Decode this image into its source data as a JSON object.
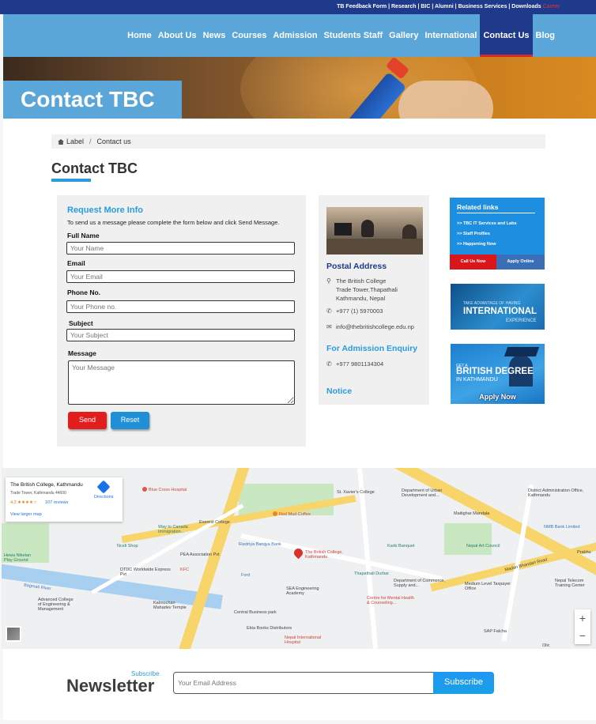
{
  "topbar": {
    "links": "TB Feedback Form | Research | BIC | Alumni | Business Services | Downloads",
    "career": "Career"
  },
  "nav": {
    "items": [
      {
        "label": "Home"
      },
      {
        "label": "About Us"
      },
      {
        "label": "News"
      },
      {
        "label": "Courses"
      },
      {
        "label": "Admission"
      },
      {
        "label": "Students Staff"
      },
      {
        "label": "Gallery"
      },
      {
        "label": "International"
      },
      {
        "label": "Contact Us"
      },
      {
        "label": "Blog"
      }
    ],
    "active": "Contact Us"
  },
  "hero": {
    "title": "Contact TBC"
  },
  "breadcrumb": {
    "home": "Label",
    "current": "Contact us"
  },
  "page_title": "Contact TBC",
  "form": {
    "heading": "Request More Info",
    "note": "To send us a message please complete the form below and click Send Message.",
    "full_name_label": "Full Name",
    "full_name_placeholder": "Your Name",
    "email_label": "Email",
    "email_placeholder": "Your Email",
    "phone_label": "Phone No.",
    "phone_placeholder": "Your Phone no.",
    "subject_label": "Subject",
    "subject_placeholder": "Your Subject",
    "message_label": "Message",
    "message_placeholder": "Your Message",
    "send_label": "Send",
    "reset_label": "Reset"
  },
  "info": {
    "postal_heading": "Postal Address",
    "address_line1": "The British College",
    "address_line2": "Trade Tower,Thapathali",
    "address_line3": "Kathmandu, Nepal",
    "phone": "+977 (1) 5970003",
    "email": "info@thebritishcollege.edu.np",
    "admission_heading": "For Admission Enquiry",
    "admission_phone": "+977 9801134304",
    "notice_heading": "Notice"
  },
  "related": {
    "title": "Related links",
    "links": [
      {
        "label": ">> TBC IT Services and Labs"
      },
      {
        "label": ">> Staff Profiles"
      },
      {
        "label": ">> Happening Now"
      }
    ],
    "call_label": "Call Us Now",
    "apply_label": "Apply Online"
  },
  "banners": {
    "intl_small": "TAKE ADVANTAGE OF HAVING",
    "intl_big": "INTERNATIONAL",
    "intl_sub": "EXPERIENCE",
    "degree_get": "GET A",
    "degree_big": "BRITISH DEGREE",
    "degree_ktm": "IN KATHMANDU",
    "degree_apply": "Apply Now"
  },
  "map": {
    "card_title": "The British College, Kathmandu",
    "card_address": "Trade Tower, Kathmandu 44600",
    "rating": "4.2 ★★★★☆",
    "reviews": "107 reviews",
    "larger_map": "View larger map",
    "directions": "Directions",
    "pin_label": "The British College, Kathmandu",
    "pois": {
      "blue_cross": "Blue Cross Hospital",
      "red_mud": "Red Mud Coffee",
      "st_xavier": "St. Xavier's College",
      "urban_dev": "Department of Urban Development and...",
      "district_admin": "District Administration Office, Kathmandu",
      "nmb": "NMB Bank Limited",
      "everest": "Everest College",
      "canada": "Way to Canada Immigration...",
      "rastriya": "Rastriya Banijya Bank",
      "karki": "Karki Banquet",
      "nepal_art": "Nepal Art Council",
      "prabhu": "Prabhu",
      "nceli": "Nceli Shop",
      "pea": "PEA Association Pvt",
      "dtdc": "DTDC Worldwide Express Pvt",
      "kfc": "KFC",
      "ford": "Ford",
      "thapathali": "Thapathali Durbar",
      "dept_commerce": "Department of Commerce, Supply and...",
      "medium": "Medium Level Taxpayer Office",
      "nepal_tele": "Nepal Telecom Training Center",
      "niketan": "Hewa Niketan Play Ground",
      "advanced": "Advanced College of Engineering & Management",
      "kalmochan": "Kalmochan Mahadev Temple",
      "sea": "SEA Engineering Academy",
      "mental": "Centre for Mental Health & Counseling...",
      "central": "Central Business park",
      "ekta": "Ekta Books Distributors",
      "nepal_intl": "Nepal International Hospital",
      "sap": "SAP Falcha",
      "bagmati": "Bagmati River",
      "maitighar": "Maitighar Mandala",
      "madan": "Madan Bhandari Road",
      "olic": "Olic"
    }
  },
  "newsletter": {
    "subscribe_small": "Subscribe",
    "title": "Newsletter",
    "placeholder": "Your Email Address",
    "button": "Subscribe"
  }
}
